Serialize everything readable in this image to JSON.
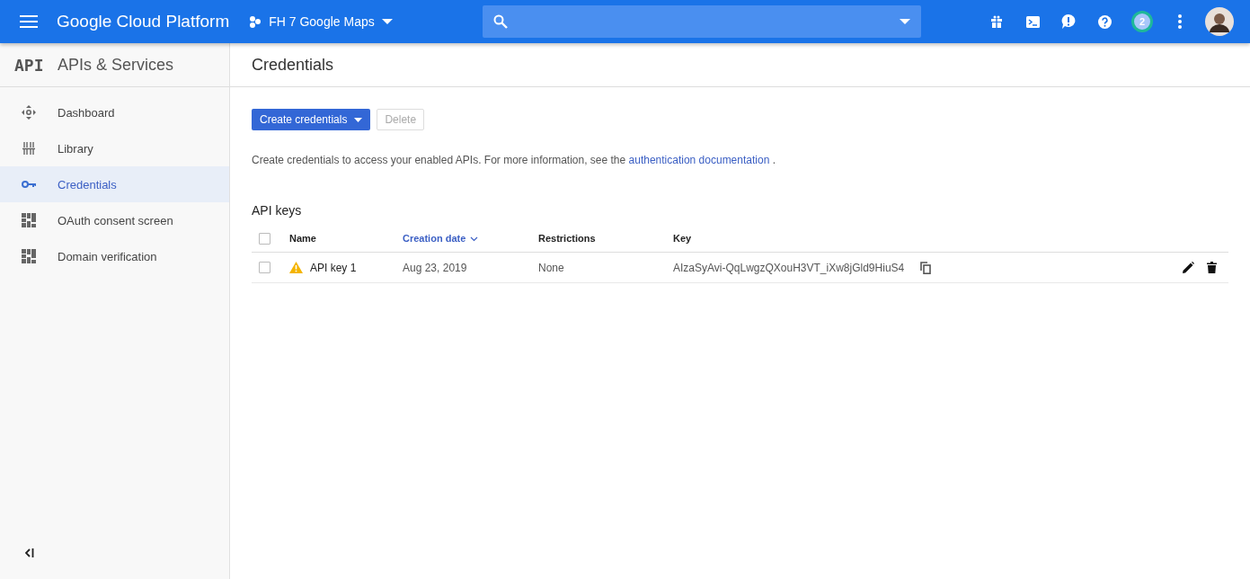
{
  "top_bar": {
    "product": "Google Cloud Platform",
    "project": "FH 7 Google Maps",
    "notification_count": "2"
  },
  "sidebar": {
    "logo": "API",
    "title": "APIs & Services",
    "items": [
      {
        "label": "Dashboard",
        "kind": "dashboard",
        "selected": false
      },
      {
        "label": "Library",
        "kind": "library",
        "selected": false
      },
      {
        "label": "Credentials",
        "kind": "key",
        "selected": true
      },
      {
        "label": "OAuth consent screen",
        "kind": "consent",
        "selected": false
      },
      {
        "label": "Domain verification",
        "kind": "consent",
        "selected": false
      }
    ]
  },
  "page": {
    "title": "Credentials",
    "create_button": "Create credentials",
    "delete_button": {
      "label": "Delete",
      "disabled": true
    },
    "info_text": "Create credentials to access your enabled APIs. For more information, see the",
    "info_link": "authentication documentation",
    "info_end": "."
  },
  "api_keys": {
    "title": "API keys",
    "select_all_checked": false,
    "columns": [
      {
        "label": "Name",
        "sorted": false
      },
      {
        "label": "Creation date",
        "sorted": true
      },
      {
        "label": "Restrictions",
        "sorted": false
      },
      {
        "label": "Key",
        "sorted": false
      }
    ],
    "rows": [
      {
        "checked": false,
        "warning": true,
        "name": "API key 1",
        "created": "Aug 23, 2019",
        "restrictions": "None",
        "key": "AIzaSyAvi-QqLwgzQXouH3VT_iXw8jGld9HiuS4"
      }
    ]
  }
}
